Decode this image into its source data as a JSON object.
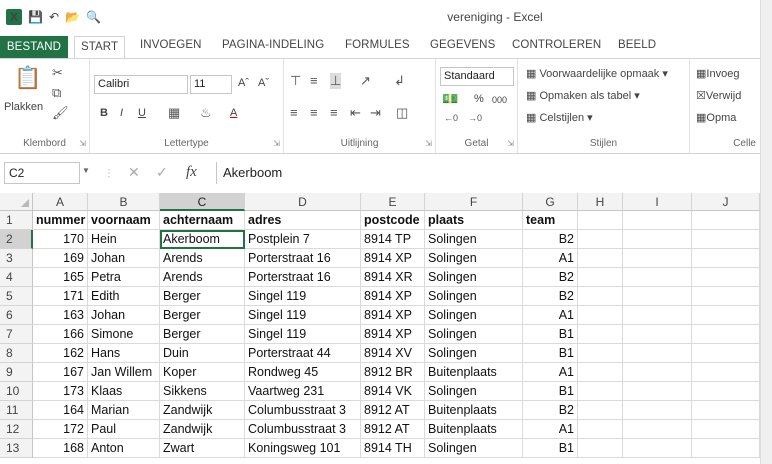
{
  "window": {
    "title": "vereniging - Excel"
  },
  "qat": {
    "save": "💾",
    "undo": "↶",
    "open": "📂",
    "preview": "🔍"
  },
  "tabs": [
    "BESTAND",
    "START",
    "INVOEGEN",
    "PAGINA-INDELING",
    "FORMULES",
    "GEGEVENS",
    "CONTROLEREN",
    "BEELD"
  ],
  "ribbon": {
    "clipboard": {
      "paste": "Plakken",
      "label": "Klembord"
    },
    "font": {
      "name": "Calibri",
      "size": "11",
      "bold": "B",
      "italic": "I",
      "underline": "U",
      "grow": "Aˆ",
      "shrink": "Aˇ",
      "fontcolor": "A",
      "label": "Lettertype"
    },
    "alignment": {
      "label": "Uitlijning"
    },
    "number": {
      "format": "Standaard",
      "percent": "%",
      "thousands": "000",
      "label": "Getal"
    },
    "styles": {
      "conditional": "Voorwaardelijke opmaak",
      "table": "Opmaken als tabel",
      "cells": "Celstijlen",
      "label": "Stijlen"
    },
    "cells": {
      "insert": "Invoeg",
      "delete": "Verwijd",
      "format": "Opma",
      "label": "Celle"
    }
  },
  "formula_bar": {
    "namebox": "C2",
    "fx": "fx",
    "cancel": "✕",
    "enter": "✓",
    "value": "Akerboom"
  },
  "columns": [
    "A",
    "B",
    "C",
    "D",
    "E",
    "F",
    "G",
    "H",
    "I",
    "J"
  ],
  "rows": [
    {
      "n": "1",
      "cells": [
        "nummer",
        "voornaam",
        "achternaam",
        "adres",
        "postcode",
        "plaats",
        "team"
      ]
    },
    {
      "n": "2",
      "cells": [
        "170",
        "Hein",
        "Akerboom",
        "Postplein 7",
        "8914 TP",
        "Solingen",
        "B2"
      ]
    },
    {
      "n": "3",
      "cells": [
        "169",
        "Johan",
        "Arends",
        "Porterstraat 16",
        "8914 XP",
        "Solingen",
        "A1"
      ]
    },
    {
      "n": "4",
      "cells": [
        "165",
        "Petra",
        "Arends",
        "Porterstraat 16",
        "8914 XR",
        "Solingen",
        "B2"
      ]
    },
    {
      "n": "5",
      "cells": [
        "171",
        "Edith",
        "Berger",
        "Singel 119",
        "8914 XP",
        "Solingen",
        "B2"
      ]
    },
    {
      "n": "6",
      "cells": [
        "163",
        "Johan",
        "Berger",
        "Singel 119",
        "8914 XP",
        "Solingen",
        "A1"
      ]
    },
    {
      "n": "7",
      "cells": [
        "166",
        "Simone",
        "Berger",
        "Singel 119",
        "8914 XP",
        "Solingen",
        "B1"
      ]
    },
    {
      "n": "8",
      "cells": [
        "162",
        "Hans",
        "Duin",
        "Porterstraat 44",
        "8914 XV",
        "Solingen",
        "B1"
      ]
    },
    {
      "n": "9",
      "cells": [
        "167",
        "Jan Willem",
        "Koper",
        "Rondweg 45",
        "8912 BR",
        "Buitenplaats",
        "A1"
      ]
    },
    {
      "n": "10",
      "cells": [
        "173",
        "Klaas",
        "Sikkens",
        "Vaartweg 231",
        "8914 VK",
        "Solingen",
        "B1"
      ]
    },
    {
      "n": "11",
      "cells": [
        "164",
        "Marian",
        "Zandwijk",
        "Columbusstraat 3",
        "8912 AT",
        "Buitenplaats",
        "B2"
      ]
    },
    {
      "n": "12",
      "cells": [
        "172",
        "Paul",
        "Zandwijk",
        "Columbusstraat 3",
        "8912 AT",
        "Buitenplaats",
        "A1"
      ]
    },
    {
      "n": "13",
      "cells": [
        "168",
        "Anton",
        "Zwart",
        "Koningsweg 101",
        "8914 TH",
        "Solingen",
        "B1"
      ]
    }
  ],
  "selection": {
    "column": "C",
    "row": "2"
  }
}
